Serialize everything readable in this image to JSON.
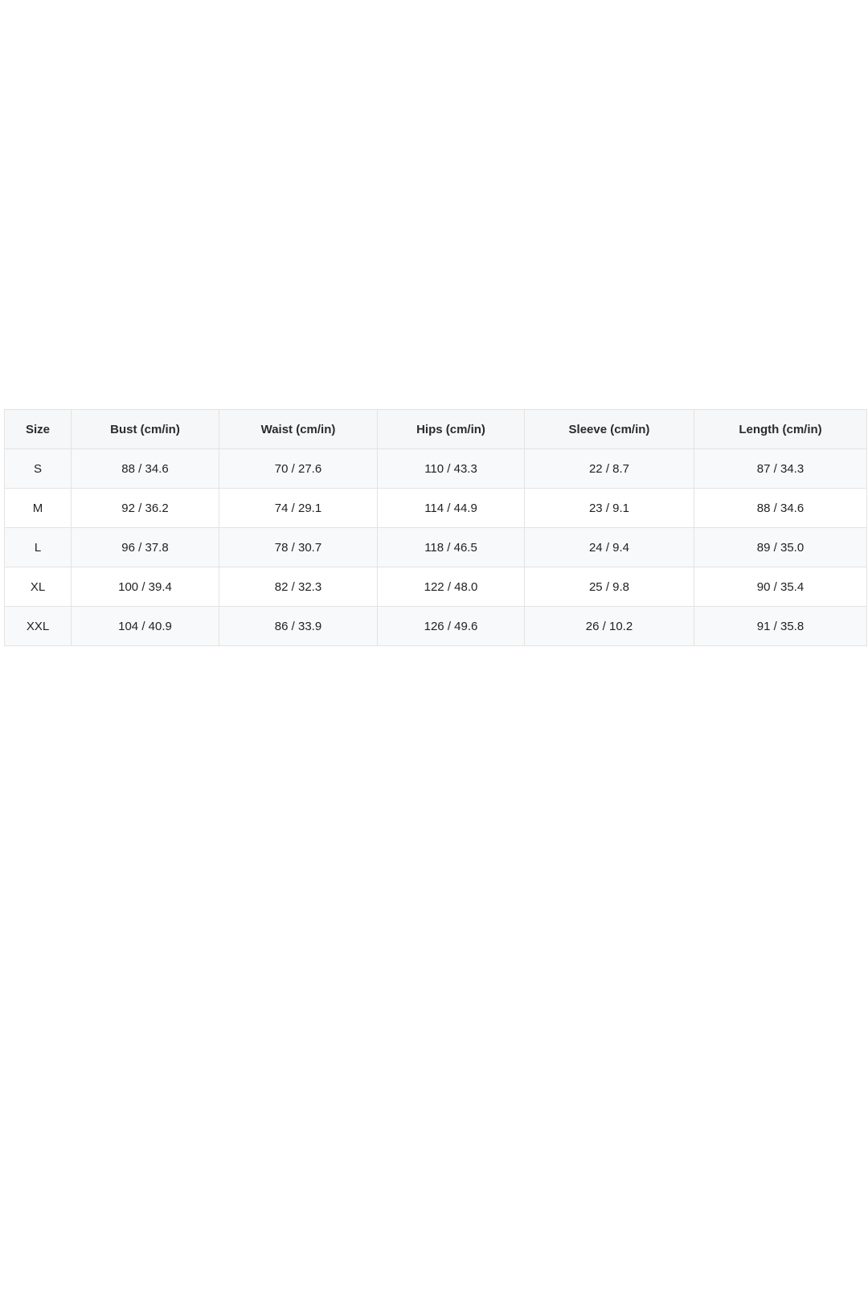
{
  "size_chart": {
    "headers": [
      "Size",
      "Bust (cm/in)",
      "Waist (cm/in)",
      "Hips (cm/in)",
      "Sleeve (cm/in)",
      "Length (cm/in)"
    ],
    "rows": [
      [
        "S",
        "88 / 34.6",
        "70 / 27.6",
        "110 / 43.3",
        "22 / 8.7",
        "87 / 34.3"
      ],
      [
        "M",
        "92 / 36.2",
        "74 / 29.1",
        "114 / 44.9",
        "23 / 9.1",
        "88 / 34.6"
      ],
      [
        "L",
        "96 / 37.8",
        "78 / 30.7",
        "118 / 46.5",
        "24 / 9.4",
        "89 / 35.0"
      ],
      [
        "XL",
        "100 / 39.4",
        "82 / 32.3",
        "122 / 48.0",
        "25 / 9.8",
        "90 / 35.4"
      ],
      [
        "XXL",
        "104 / 40.9",
        "86 / 33.9",
        "126 / 49.6",
        "26 / 10.2",
        "91 / 35.8"
      ]
    ]
  }
}
